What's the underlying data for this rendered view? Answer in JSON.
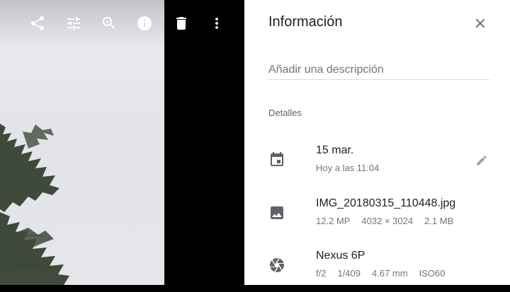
{
  "toolbar": {
    "buttons": [
      {
        "name": "share-icon"
      },
      {
        "name": "edit-tune-icon"
      },
      {
        "name": "zoom-in-icon"
      },
      {
        "name": "info-icon"
      },
      {
        "name": "delete-icon"
      },
      {
        "name": "more-vert-icon"
      }
    ]
  },
  "info_panel": {
    "title": "Información",
    "description_placeholder": "Añadir una descripción",
    "section_label": "Detalles",
    "date": {
      "icon": "calendar-icon",
      "primary": "15 mar.",
      "secondary": "Hoy a las 11:04"
    },
    "file": {
      "icon": "image-icon",
      "primary": "IMG_20180315_110448.jpg",
      "megapixels": "12.2 MP",
      "resolution": "4032 × 3024",
      "size": "2.1 MB"
    },
    "camera": {
      "icon": "camera-aperture-icon",
      "primary": "Nexus 6P",
      "aperture": "f/2",
      "shutter": "1/409",
      "focal_length": "4.67 mm",
      "iso": "ISO60"
    }
  },
  "colors": {
    "panel_bg": "#ffffff",
    "viewer_bg": "#000000",
    "text_primary": "#202124",
    "text_secondary": "#70757a",
    "icon_gray": "#5f6368"
  }
}
